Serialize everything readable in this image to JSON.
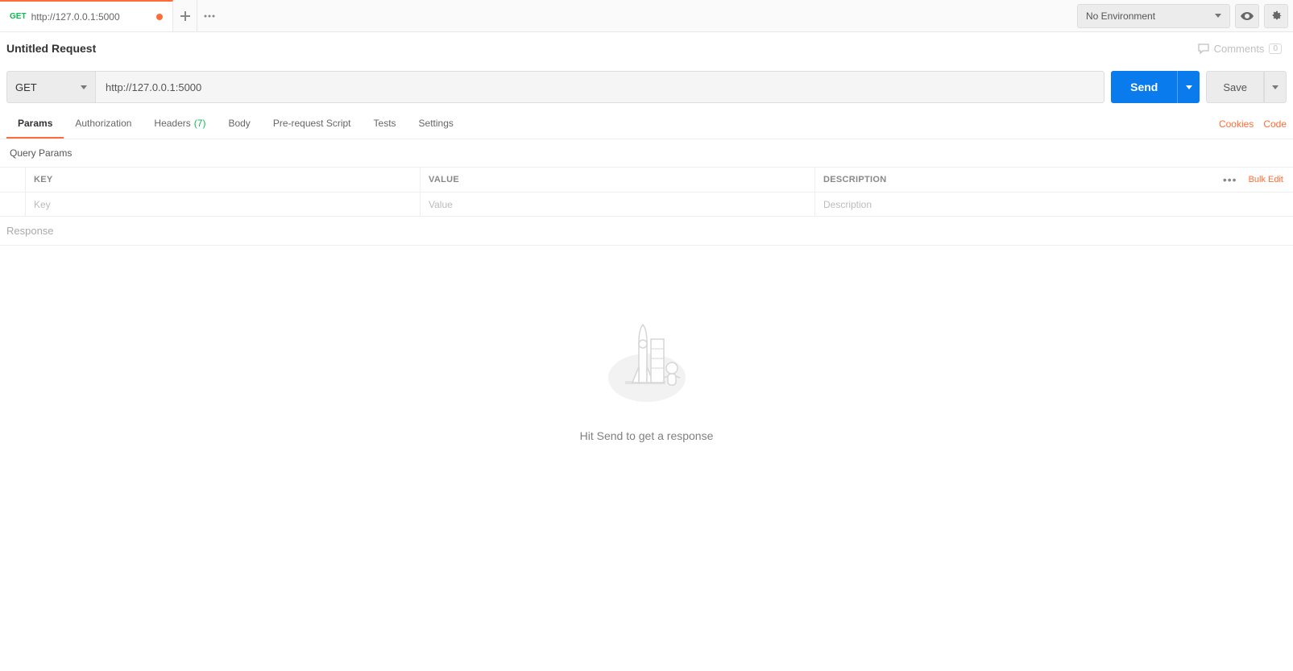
{
  "topbar": {
    "tab_method": "GET",
    "tab_title": "http://127.0.0.1:5000",
    "env_label": "No Environment"
  },
  "title_row": {
    "request_title": "Untitled Request",
    "comments_label": "Comments",
    "comments_count": "0"
  },
  "url_bar": {
    "method": "GET",
    "url": "http://127.0.0.1:5000",
    "send_label": "Send",
    "save_label": "Save"
  },
  "req_tabs": {
    "params": "Params",
    "authorization": "Authorization",
    "headers": "Headers",
    "headers_count": "(7)",
    "body": "Body",
    "prerequest": "Pre-request Script",
    "tests": "Tests",
    "settings": "Settings",
    "cookies": "Cookies",
    "code": "Code"
  },
  "params": {
    "section_label": "Query Params",
    "header_key": "KEY",
    "header_value": "VALUE",
    "header_desc": "DESCRIPTION",
    "bulk_edit": "Bulk Edit",
    "placeholder_key": "Key",
    "placeholder_value": "Value",
    "placeholder_desc": "Description"
  },
  "response": {
    "label": "Response",
    "empty_msg": "Hit Send to get a response"
  }
}
